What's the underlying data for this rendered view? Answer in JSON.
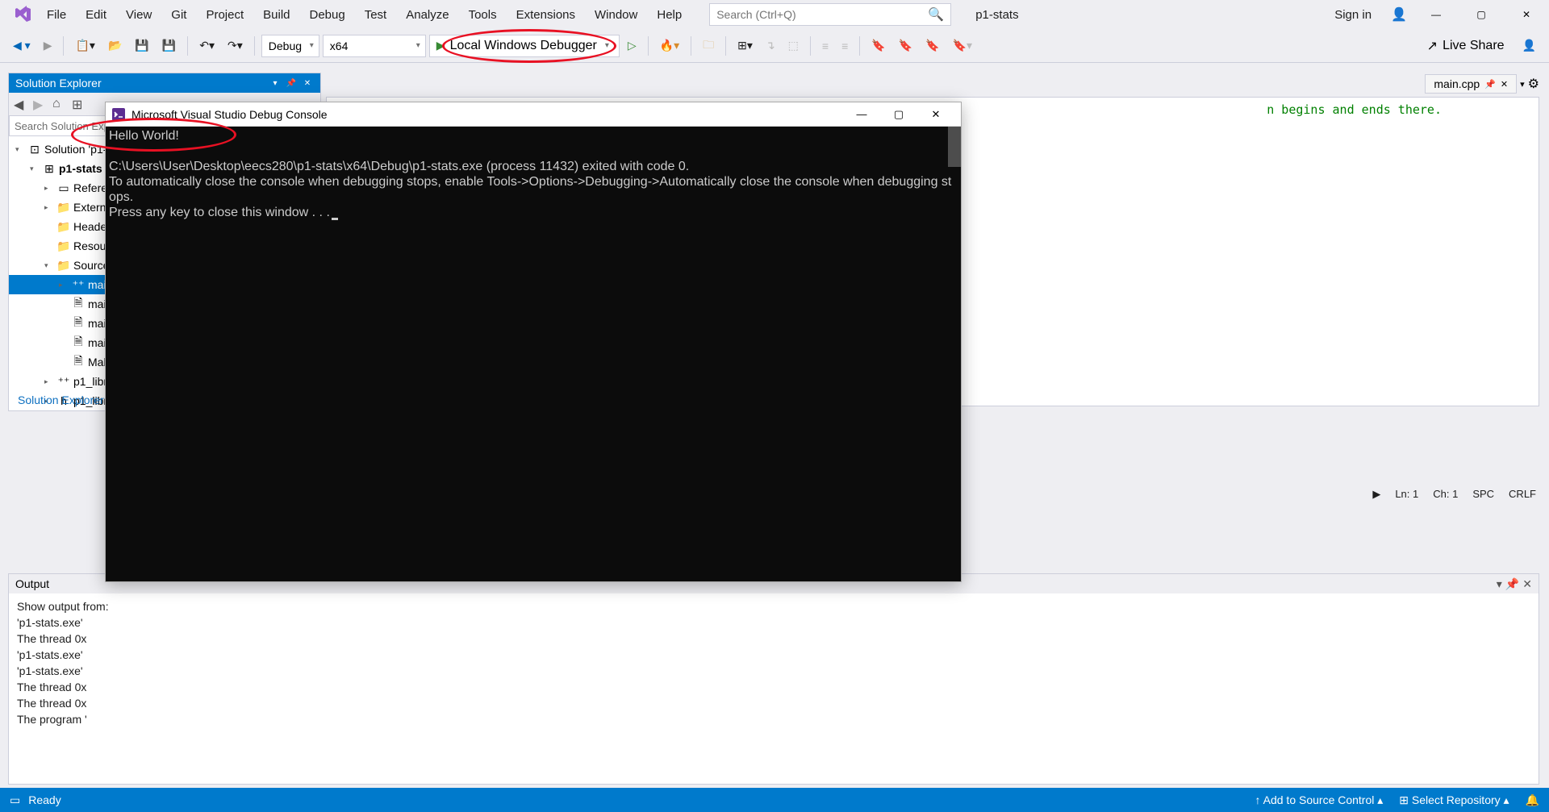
{
  "menu": [
    "File",
    "Edit",
    "View",
    "Git",
    "Project",
    "Build",
    "Debug",
    "Test",
    "Analyze",
    "Tools",
    "Extensions",
    "Window",
    "Help"
  ],
  "title_search_placeholder": "Search (Ctrl+Q)",
  "project_name": "p1-stats",
  "signin": "Sign in",
  "toolbar": {
    "config": "Debug",
    "platform": "x64",
    "debugger": "Local Windows Debugger",
    "liveshare": "Live Share"
  },
  "solution_explorer": {
    "title": "Solution Explorer",
    "search_placeholder": "Search Solution Explorer (Ctrl+;)",
    "root": "Solution 'p1-stats'",
    "items": [
      {
        "indent": 1,
        "arrow": "▾",
        "icon": "project",
        "label": "p1-stats",
        "bold": true
      },
      {
        "indent": 2,
        "arrow": "▸",
        "icon": "ref",
        "label": "References"
      },
      {
        "indent": 2,
        "arrow": "▸",
        "icon": "folder",
        "label": "External Dependencies"
      },
      {
        "indent": 2,
        "arrow": "",
        "icon": "folder",
        "label": "Header Files"
      },
      {
        "indent": 2,
        "arrow": "",
        "icon": "folder",
        "label": "Resource Files"
      },
      {
        "indent": 2,
        "arrow": "▾",
        "icon": "folder",
        "label": "Source Files"
      },
      {
        "indent": 3,
        "arrow": "▸",
        "icon": "cpp",
        "label": "main.cpp",
        "selected": true
      },
      {
        "indent": 3,
        "arrow": "",
        "icon": "file",
        "label": "main_test.in"
      },
      {
        "indent": 3,
        "arrow": "",
        "icon": "file",
        "label": "main_test.out.correct"
      },
      {
        "indent": 3,
        "arrow": "",
        "icon": "file",
        "label": "main_test_data.tsv"
      },
      {
        "indent": 3,
        "arrow": "",
        "icon": "file",
        "label": "Makefile"
      },
      {
        "indent": 2,
        "arrow": "▸",
        "icon": "cpp",
        "label": "p1_library.cpp"
      },
      {
        "indent": 2,
        "arrow": "▸",
        "icon": "hpp",
        "label": "p1_library.h"
      }
    ],
    "tab": "Solution Explorer"
  },
  "editor": {
    "tab": "main.cpp",
    "visible_text": "n begins and ends there.",
    "status": {
      "ln": "Ln: 1",
      "ch": "Ch: 1",
      "spc": "SPC",
      "crlf": "CRLF"
    }
  },
  "output": {
    "title": "Output",
    "show_from": "Show output from:",
    "lines": [
      "'p1-stats.exe'",
      "The thread 0x",
      "'p1-stats.exe'",
      "'p1-stats.exe'",
      "The thread 0x",
      "The thread 0x",
      "The program '"
    ]
  },
  "statusbar": {
    "ready": "Ready",
    "source_control": "Add to Source Control",
    "repo": "Select Repository"
  },
  "console": {
    "title": "Microsoft Visual Studio Debug Console",
    "body": "Hello World!\n\nC:\\Users\\User\\Desktop\\eecs280\\p1-stats\\x64\\Debug\\p1-stats.exe (process 11432) exited with code 0.\nTo automatically close the console when debugging stops, enable Tools->Options->Debugging->Automatically close the console when debugging stops.\nPress any key to close this window . . ."
  }
}
